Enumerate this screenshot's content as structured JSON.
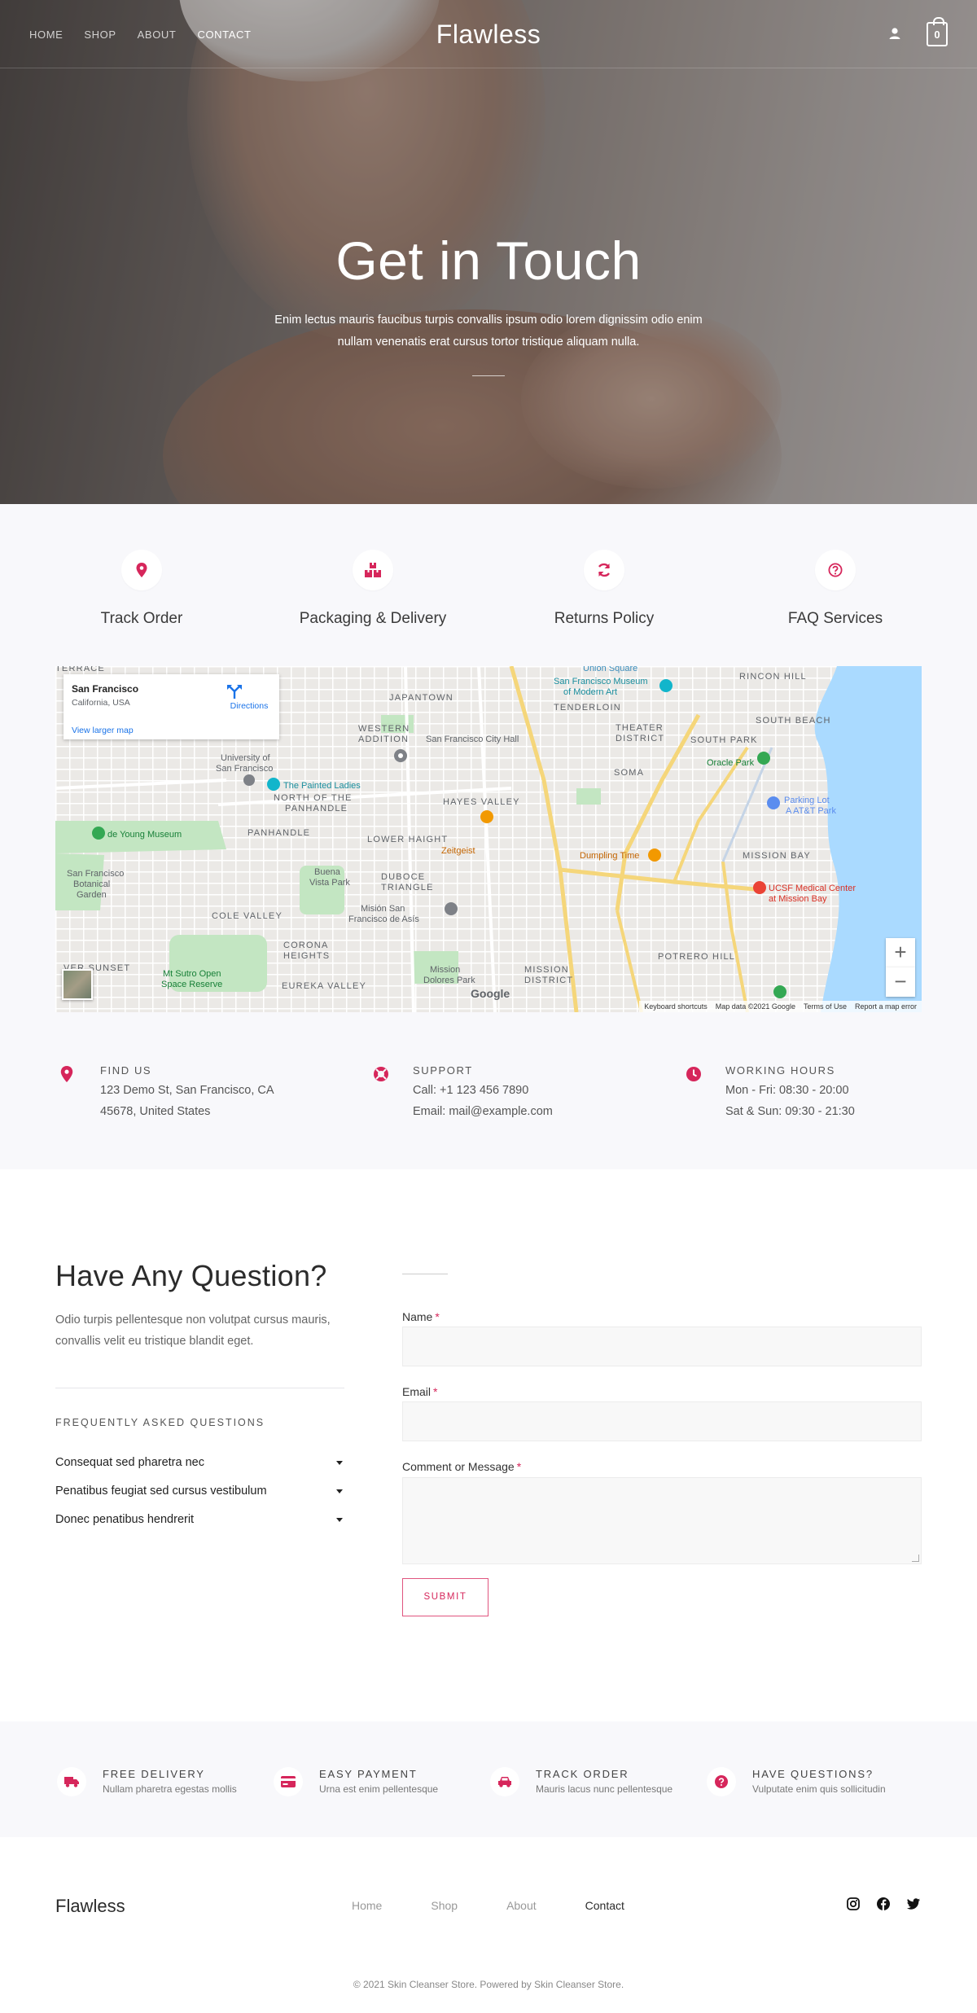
{
  "nav": {
    "links": [
      "HOME",
      "SHOP",
      "ABOUT",
      "CONTACT"
    ],
    "active": "CONTACT",
    "brand": "Flawless",
    "cart_count": "0"
  },
  "hero": {
    "title": "Get in Touch",
    "subtitle": "Enim lectus mauris faucibus turpis convallis ipsum odio lorem dignissim odio enim nullam venenatis erat cursus tortor tristique aliquam nulla."
  },
  "features": [
    {
      "label": "Track Order",
      "icon": "map-pin-icon"
    },
    {
      "label": "Packaging & Delivery",
      "icon": "boxes-icon"
    },
    {
      "label": "Returns Policy",
      "icon": "refresh-icon"
    },
    {
      "label": "FAQ Services",
      "icon": "question-circle-icon"
    }
  ],
  "map": {
    "place_name": "San Francisco",
    "place_region": "California, USA",
    "directions_label": "Directions",
    "larger_map_link": "View larger map",
    "labels": [
      "Union Square",
      "San Francisco Museum of Modern Art",
      "RINCON HILL",
      "JAPANTOWN",
      "TENDERLOIN",
      "SOUTH BEACH",
      "WESTERN ADDITION",
      "San Francisco City Hall",
      "THEATER DISTRICT",
      "SOUTH PARK",
      "University of San Francisco",
      "Oracle Park",
      "The Painted Ladies",
      "SOMA",
      "NORTH OF THE PANHANDLE",
      "HAYES VALLEY",
      "Parking Lot A AT&T Park",
      "de Young Museum",
      "PANHANDLE",
      "LOWER HAIGHT",
      "Zeitgeist",
      "Dumpling Time",
      "MISSION BAY",
      "San Francisco Botanical Garden",
      "Buena Vista Park",
      "DUBOCE TRIANGLE",
      "UCSF Medical Center at Mission Bay",
      "COLE VALLEY",
      "Misión San Francisco de Asís",
      "CORONA HEIGHTS",
      "POTRERO HILL",
      "Mt Sutro Open Space Reserve",
      "EUREKA VALLEY",
      "Mission Dolores Park",
      "MISSION DISTRICT",
      "Google"
    ],
    "footer": [
      "Keyboard shortcuts",
      "Map data ©2021 Google",
      "Terms of Use",
      "Report a map error"
    ],
    "zoom_in": "+",
    "zoom_out": "−"
  },
  "contact_info": [
    {
      "heading": "FIND US",
      "line1": "123 Demo St, San Francisco, CA",
      "line2": "45678, United States",
      "icon": "map-pin-icon"
    },
    {
      "heading": "SUPPORT",
      "line1": "Call: +1 123 456 7890",
      "line2": "Email: mail@example.com",
      "icon": "lifebuoy-icon"
    },
    {
      "heading": "WORKING HOURS",
      "line1": "Mon - Fri: 08:30 - 20:00",
      "line2": "Sat & Sun: 09:30 - 21:30",
      "icon": "clock-icon"
    }
  ],
  "question": {
    "title": "Have Any Question?",
    "subtitle": "Odio turpis pellentesque non volutpat cursus mauris, convallis velit eu tristique blandit eget.",
    "faq_heading": "FREQUENTLY ASKED QUESTIONS",
    "faq_items": [
      "Consequat sed pharetra nec",
      "Penatibus feugiat sed cursus vestibulum",
      "Donec penatibus hendrerit"
    ]
  },
  "form": {
    "name_label": "Name",
    "email_label": "Email",
    "comment_label": "Comment or Message",
    "required_mark": "*",
    "submit_label": "SUBMIT"
  },
  "benefits": [
    {
      "title": "FREE DELIVERY",
      "subtitle": "Nullam pharetra egestas mollis",
      "icon": "truck-icon"
    },
    {
      "title": "EASY PAYMENT",
      "subtitle": "Urna est enim pellentesque",
      "icon": "credit-card-icon"
    },
    {
      "title": "TRACK ORDER",
      "subtitle": "Mauris lacus nunc pellentesque",
      "icon": "car-icon"
    },
    {
      "title": "HAVE QUESTIONS?",
      "subtitle": "Vulputate enim quis sollicitudin",
      "icon": "question-circle-icon"
    }
  ],
  "footer": {
    "brand": "Flawless",
    "links": [
      "Home",
      "Shop",
      "About",
      "Contact"
    ],
    "active": "Contact",
    "socials": [
      "instagram-icon",
      "facebook-icon",
      "twitter-icon"
    ],
    "copyright": "© 2021 Skin Cleanser Store. Powered by Skin Cleanser Store."
  },
  "colors": {
    "accent": "#d6265b",
    "light_bg": "#f8f8fb",
    "text": "#2b2b2b"
  }
}
